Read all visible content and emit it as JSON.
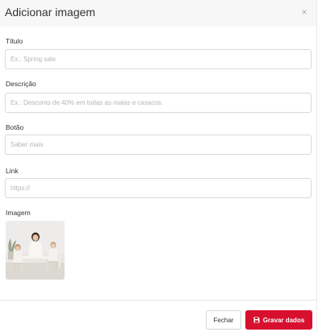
{
  "modal": {
    "title": "Adicionar imagem",
    "close_symbol": "×"
  },
  "fields": {
    "title": {
      "label": "Título",
      "placeholder": "Ex.: Spring sale",
      "value": ""
    },
    "description": {
      "label": "Descrição",
      "placeholder": "Ex.: Desconto de 40% em todas as malas e casacos.",
      "value": ""
    },
    "button": {
      "label": "Botão",
      "placeholder": "Saber mais",
      "value": ""
    },
    "link": {
      "label": "Link",
      "placeholder": "https://",
      "value": ""
    },
    "image": {
      "label": "Imagem"
    }
  },
  "footer": {
    "close_label": "Fechar",
    "save_label": "Gravar dados",
    "save_icon": "floppy-disk-icon"
  },
  "colors": {
    "primary": "#d8102f",
    "header_bg": "#f7f7f7",
    "border": "#d9d9d9",
    "placeholder": "#b5b5b5"
  }
}
